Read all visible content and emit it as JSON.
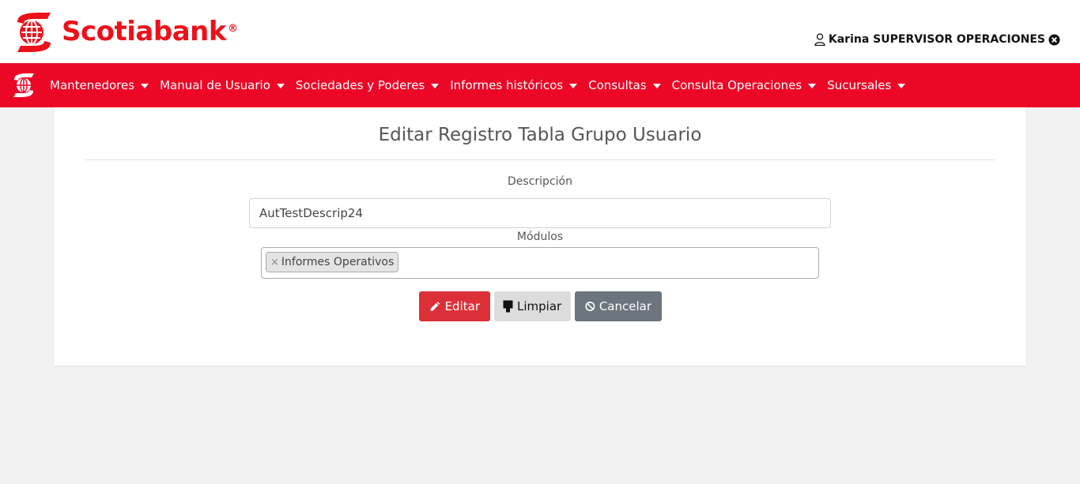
{
  "brand": {
    "name": "Scotiabank",
    "reg": "®",
    "color": "#ec111a"
  },
  "user": {
    "name": "Karina SUPERVISOR OPERACIONES",
    "icon": "user-icon",
    "logout_icon": "close-circle-icon"
  },
  "nav": {
    "color": "#ec0727",
    "items": [
      {
        "label": "Mantenedores"
      },
      {
        "label": "Manual de Usuario"
      },
      {
        "label": "Sociedades y Poderes"
      },
      {
        "label": "Informes históricos"
      },
      {
        "label": "Consultas"
      },
      {
        "label": "Consulta Operaciones"
      },
      {
        "label": "Sucursales"
      }
    ]
  },
  "form": {
    "title": "Editar Registro Tabla Grupo Usuario",
    "description_label": "Descripción",
    "description_value": "AutTestDescrip24",
    "modules_label": "Módulos",
    "selected_modules": [
      {
        "label": "Informes Operativos",
        "remove": "×"
      }
    ]
  },
  "buttons": {
    "edit": {
      "label": "Editar",
      "icon": "pencil-icon",
      "color": "#dc3039"
    },
    "clear": {
      "label": "Limpiar",
      "icon": "eraser-icon",
      "color": "#dcdcdc"
    },
    "cancel": {
      "label": "Cancelar",
      "icon": "ban-icon",
      "color": "#6c757d"
    }
  }
}
